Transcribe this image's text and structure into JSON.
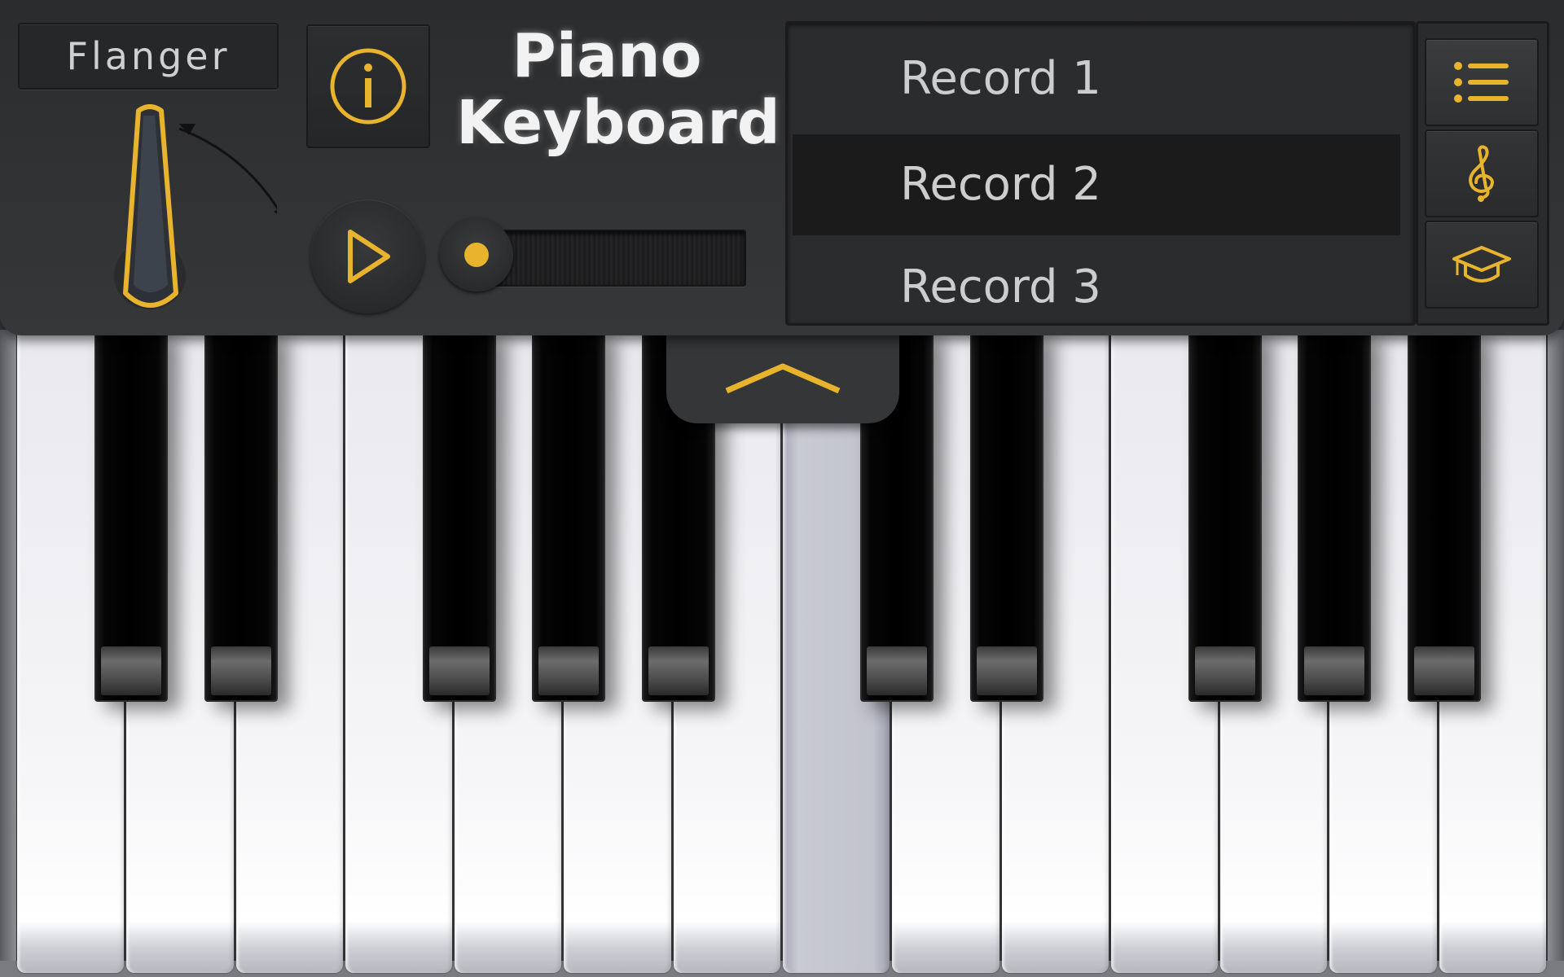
{
  "app": {
    "title_line1": "Piano",
    "title_line2": "Keyboard"
  },
  "effect": {
    "name": "Flanger"
  },
  "records": [
    {
      "label": "Record 1",
      "selected": false
    },
    {
      "label": "Record 2",
      "selected": true
    },
    {
      "label": "Record 3",
      "selected": false
    }
  ],
  "side_menu": [
    {
      "icon": "list-icon",
      "active": true
    },
    {
      "icon": "treble-clef-icon",
      "active": false
    },
    {
      "icon": "graduation-cap-icon",
      "active": false
    }
  ],
  "playback": {
    "progress": 0.0
  },
  "keyboard": {
    "white_key_count": 14,
    "pressed_white_key_index": 7,
    "black_keys_after_white": [
      0,
      1,
      3,
      4,
      5,
      7,
      8,
      10,
      11,
      12
    ]
  },
  "colors": {
    "accent": "#e8b32d",
    "panel": "#2b2c2e"
  }
}
